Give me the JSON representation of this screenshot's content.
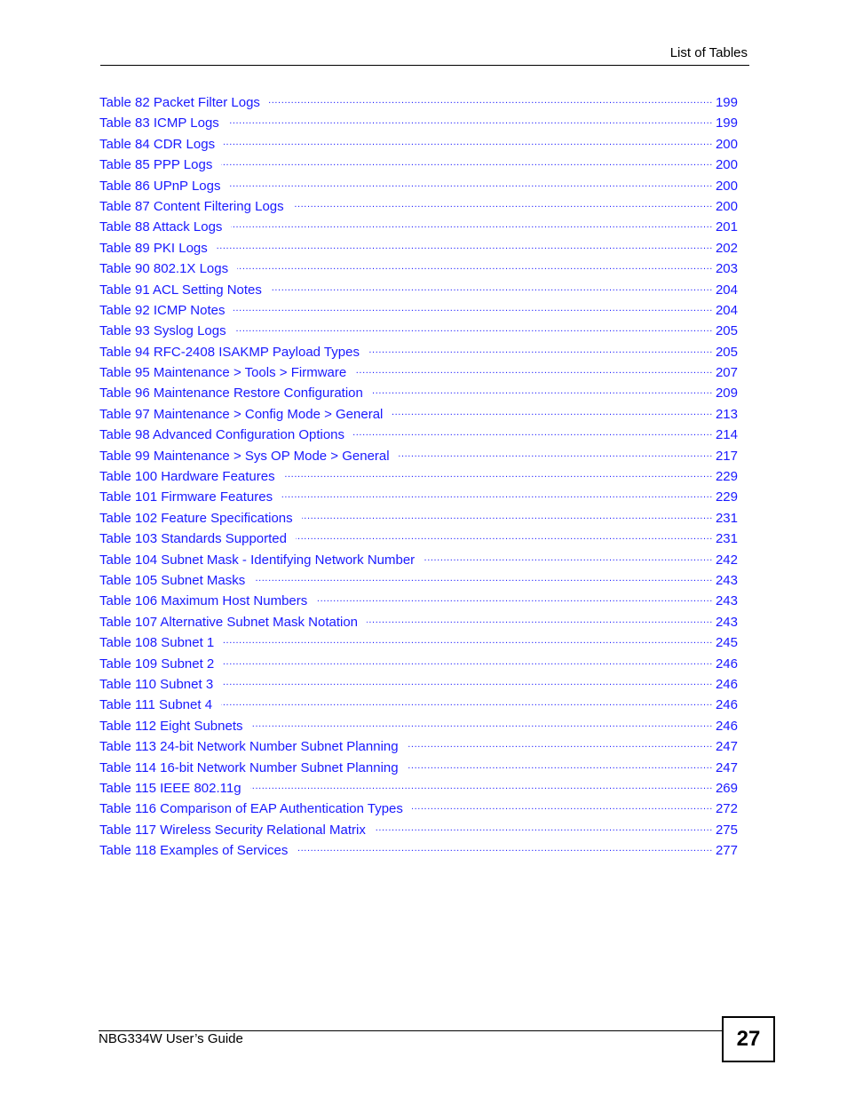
{
  "header": {
    "section_title": "List of Tables"
  },
  "toc": {
    "link_color": "#1a1aff",
    "entries": [
      {
        "label": "Table 82 Packet Filter Logs",
        "page": "199"
      },
      {
        "label": "Table 83 ICMP Logs",
        "page": "199"
      },
      {
        "label": "Table 84 CDR Logs",
        "page": "200"
      },
      {
        "label": "Table 85 PPP Logs",
        "page": "200"
      },
      {
        "label": "Table 86 UPnP Logs",
        "page": "200"
      },
      {
        "label": "Table 87 Content Filtering Logs",
        "page": "200"
      },
      {
        "label": "Table 88 Attack Logs",
        "page": "201"
      },
      {
        "label": "Table 89 PKI Logs",
        "page": "202"
      },
      {
        "label": "Table 90 802.1X Logs",
        "page": "203"
      },
      {
        "label": "Table 91 ACL Setting Notes",
        "page": "204"
      },
      {
        "label": "Table 92 ICMP Notes",
        "page": "204"
      },
      {
        "label": "Table 93 Syslog Logs",
        "page": "205"
      },
      {
        "label": "Table 94 RFC-2408 ISAKMP Payload Types",
        "page": "205"
      },
      {
        "label": "Table 95 Maintenance > Tools > Firmware",
        "page": "207"
      },
      {
        "label": "Table 96 Maintenance Restore Configuration",
        "page": "209"
      },
      {
        "label": "Table 97 Maintenance > Config Mode > General",
        "page": "213"
      },
      {
        "label": "Table 98 Advanced Configuration Options",
        "page": "214"
      },
      {
        "label": "Table 99 Maintenance > Sys OP Mode > General",
        "page": "217"
      },
      {
        "label": "Table 100 Hardware Features",
        "page": "229"
      },
      {
        "label": "Table 101 Firmware Features",
        "page": "229"
      },
      {
        "label": "Table 102 Feature Specifications",
        "page": "231"
      },
      {
        "label": "Table 103 Standards Supported",
        "page": "231"
      },
      {
        "label": "Table 104 Subnet Mask - Identifying Network Number",
        "page": "242"
      },
      {
        "label": "Table 105 Subnet Masks",
        "page": "243"
      },
      {
        "label": "Table 106 Maximum Host Numbers",
        "page": "243"
      },
      {
        "label": "Table 107 Alternative Subnet Mask Notation",
        "page": "243"
      },
      {
        "label": "Table 108 Subnet 1",
        "page": "245"
      },
      {
        "label": "Table 109 Subnet 2",
        "page": "246"
      },
      {
        "label": "Table 110 Subnet 3",
        "page": "246"
      },
      {
        "label": "Table 111 Subnet 4",
        "page": "246"
      },
      {
        "label": "Table 112 Eight Subnets",
        "page": "246"
      },
      {
        "label": "Table 113 24-bit Network Number Subnet Planning",
        "page": "247"
      },
      {
        "label": "Table 114 16-bit Network Number Subnet Planning",
        "page": "247"
      },
      {
        "label": "Table 115 IEEE 802.11g",
        "page": "269"
      },
      {
        "label": "Table 116 Comparison of EAP Authentication Types",
        "page": "272"
      },
      {
        "label": "Table 117 Wireless Security Relational Matrix",
        "page": "275"
      },
      {
        "label": "Table 118 Examples of Services",
        "page": "277"
      }
    ]
  },
  "footer": {
    "guide_title": "NBG334W User’s Guide",
    "page_number": "27"
  }
}
